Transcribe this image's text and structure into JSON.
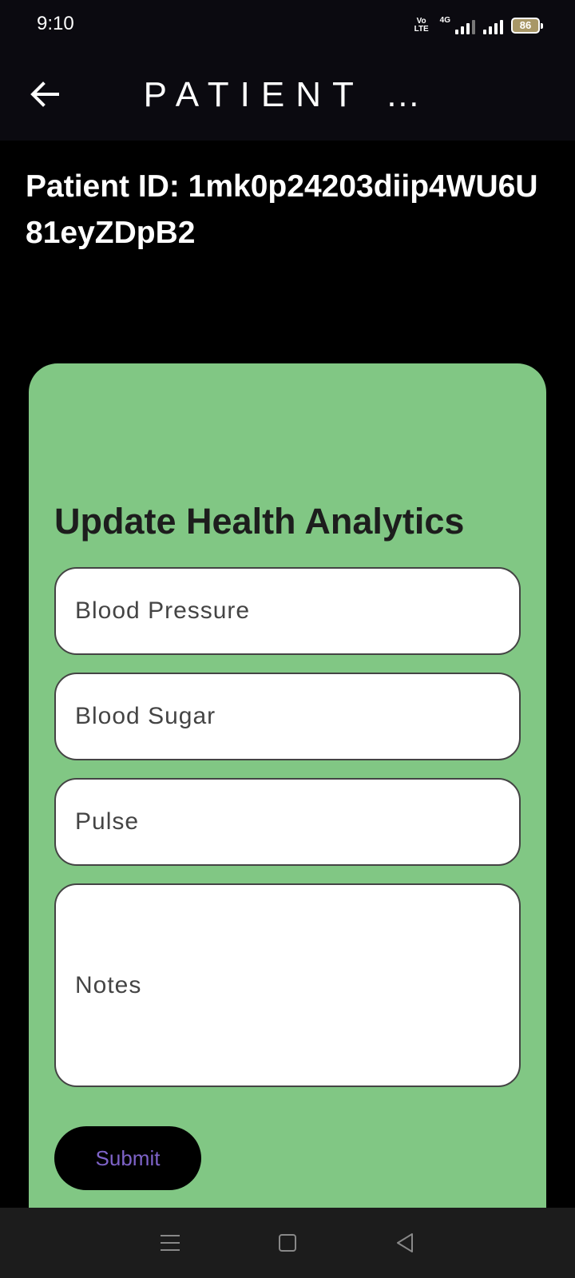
{
  "status_bar": {
    "time": "9:10",
    "volte_label": "Vo LTE",
    "network_label": "4G",
    "battery_level": "86"
  },
  "app_bar": {
    "title": "PATIENT …",
    "back_icon": "arrow-left-icon"
  },
  "patient": {
    "id_text": "Patient ID: 1mk0p24203diip4WU6U81eyZDpB2"
  },
  "form": {
    "title": "Update Health Analytics",
    "fields": {
      "blood_pressure": {
        "placeholder": "Blood Pressure",
        "value": ""
      },
      "blood_sugar": {
        "placeholder": "Blood Sugar",
        "value": ""
      },
      "pulse": {
        "placeholder": "Pulse",
        "value": ""
      },
      "notes": {
        "placeholder": "Notes",
        "value": ""
      }
    },
    "submit_label": "Submit"
  },
  "colors": {
    "card_bg": "#81c784",
    "app_bar_bg": "#0b0a10",
    "submit_text": "#7e63c8"
  },
  "nav_bar": {
    "icons": [
      "menu-icon",
      "home-square-icon",
      "back-triangle-icon"
    ]
  }
}
